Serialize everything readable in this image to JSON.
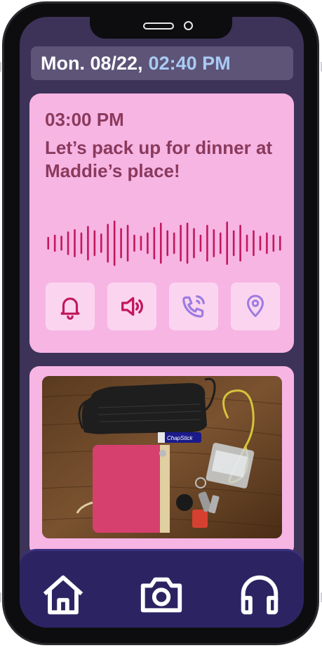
{
  "status_bar": {
    "date": "Mon. 08/22,",
    "time": "02:40 PM"
  },
  "reminder": {
    "time": "03:00 PM",
    "message": "Let’s pack up for dinner at Maddie’s place!",
    "waveform_levels": [
      0.25,
      0.35,
      0.3,
      0.5,
      0.6,
      0.45,
      0.75,
      0.55,
      0.4,
      0.85,
      1.0,
      0.65,
      0.8,
      0.35,
      0.3,
      0.45,
      0.7,
      0.9,
      0.55,
      0.45,
      0.8,
      0.9,
      0.65,
      0.35,
      0.8,
      0.6,
      0.45,
      0.95,
      0.55,
      0.8,
      0.35,
      0.55,
      0.3,
      0.45,
      0.35,
      0.3
    ],
    "actions": [
      {
        "name": "bell-icon",
        "color": "#c2185b"
      },
      {
        "name": "speaker-icon",
        "color": "#c2185b"
      },
      {
        "name": "phone-call-icon",
        "color": "#9b7be0"
      },
      {
        "name": "location-pin-icon",
        "color": "#9b7be0"
      }
    ]
  },
  "photo": {
    "chapstick_label": "ChapStick"
  },
  "nav": {
    "items": [
      "home-icon",
      "camera-icon",
      "headphones-icon"
    ]
  },
  "colors": {
    "screen_bg": "#3d3358",
    "card_bg": "#f7b5e4",
    "text_accent": "#8a3a5c",
    "wave_color": "#c2185b",
    "nav_bg": "#2c2462",
    "time_highlight": "#a9cbf5"
  }
}
